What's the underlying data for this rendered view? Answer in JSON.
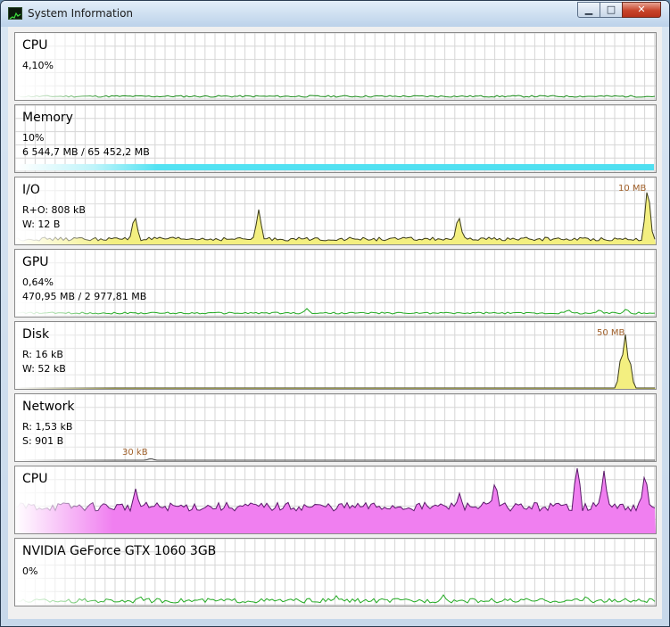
{
  "window": {
    "title": "System Information",
    "icon": "chart-app-icon"
  },
  "controls": {
    "minimize": "▁",
    "maximize": "□",
    "close": "✕"
  },
  "panels": [
    {
      "id": "cpu",
      "title": "CPU",
      "lines": [
        "4,10%",
        ""
      ],
      "peak": "",
      "graph": {
        "type": "line",
        "color": "#1a8c1a",
        "fill": ""
      }
    },
    {
      "id": "memory",
      "title": "Memory",
      "lines": [
        "10%",
        "6 544,7 MB / 65 452,2 MB"
      ],
      "peak": "",
      "graph": {
        "type": "bar",
        "color": "#4fdff0",
        "fill": "",
        "level": 0.1
      }
    },
    {
      "id": "io",
      "title": "I/O",
      "lines": [
        "R+O: 808 kB",
        "W: 12 B"
      ],
      "peak": "10 MB",
      "graph": {
        "type": "area",
        "color": "#3b3b1a",
        "fill": "#f3ef80"
      }
    },
    {
      "id": "gpu",
      "title": "GPU",
      "lines": [
        "0,64%",
        "470,95 MB / 2 977,81 MB"
      ],
      "peak": "",
      "graph": {
        "type": "line",
        "color": "#22aa22",
        "fill": ""
      }
    },
    {
      "id": "disk",
      "title": "Disk",
      "lines": [
        "R: 16 kB",
        "W: 52 kB"
      ],
      "peak": "50 MB",
      "graph": {
        "type": "area",
        "color": "#3b3b1a",
        "fill": "#f3ef80"
      }
    },
    {
      "id": "network",
      "title": "Network",
      "lines": [
        "R: 1,53 kB",
        "S: 901 B"
      ],
      "peak": "30 kB",
      "graph": {
        "type": "line",
        "color": "#444444",
        "fill": ""
      }
    },
    {
      "id": "cpu-cores",
      "title": "CPU",
      "lines": [
        "",
        ""
      ],
      "peak": "",
      "graph": {
        "type": "area",
        "color": "#5a1a6a",
        "fill": "#f07ff0"
      }
    },
    {
      "id": "gpu-device",
      "title": "NVIDIA GeForce GTX 1060 3GB",
      "lines": [
        "0%",
        ""
      ],
      "peak": "",
      "graph": {
        "type": "line",
        "color": "#22aa22",
        "fill": ""
      }
    }
  ]
}
